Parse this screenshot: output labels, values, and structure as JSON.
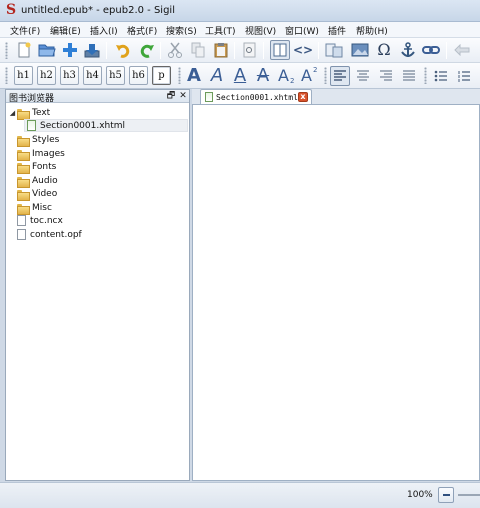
{
  "window": {
    "title": "untitled.epub* - epub2.0 - Sigil",
    "app_logo": "S"
  },
  "menu": [
    "文件(F)",
    "编辑(E)",
    "插入(I)",
    "格式(F)",
    "搜索(S)",
    "工具(T)",
    "视图(V)",
    "窗口(W)",
    "插件",
    "帮助(H)"
  ],
  "toolbar1": {
    "icons": [
      "new-file-icon",
      "open-folder-icon",
      "add-icon",
      "save-icon",
      "undo-icon",
      "redo-icon",
      "cut-icon",
      "copy-icon",
      "paste-icon",
      "find-icon",
      "book-view-icon",
      "code-view-icon",
      "metadata-icon",
      "insert-image-icon",
      "special-character-icon",
      "anchor-icon",
      "link-icon",
      "back-icon"
    ],
    "omega": "Ω",
    "code": "<>"
  },
  "toolbar2": {
    "headings": [
      "h1",
      "h2",
      "h3",
      "h4",
      "h5",
      "h6",
      "p"
    ],
    "active_heading": "p",
    "format_glyphs": [
      "A",
      "A",
      "A",
      "A",
      "A",
      "A"
    ],
    "subscript": "2",
    "superscript": "2"
  },
  "book_browser": {
    "title": "图书浏览器",
    "float_glyph": "🗗",
    "close_glyph": "✕",
    "items": [
      {
        "label": "Text",
        "type": "folder",
        "expanded": true
      },
      {
        "label": "Section0001.xhtml",
        "type": "file"
      },
      {
        "label": "Styles",
        "type": "folder"
      },
      {
        "label": "Images",
        "type": "folder"
      },
      {
        "label": "Fonts",
        "type": "folder"
      },
      {
        "label": "Audio",
        "type": "folder"
      },
      {
        "label": "Video",
        "type": "folder"
      },
      {
        "label": "Misc",
        "type": "folder"
      },
      {
        "label": "toc.ncx",
        "type": "file"
      },
      {
        "label": "content.opf",
        "type": "file"
      }
    ]
  },
  "editor": {
    "tab_label": "Section0001.xhtml",
    "close_glyph": "x"
  },
  "status": {
    "zoom": "100%"
  },
  "colors": {
    "accent": "#3b5e95",
    "tab_close": "#d9532c",
    "folder": "#e3b44b"
  }
}
